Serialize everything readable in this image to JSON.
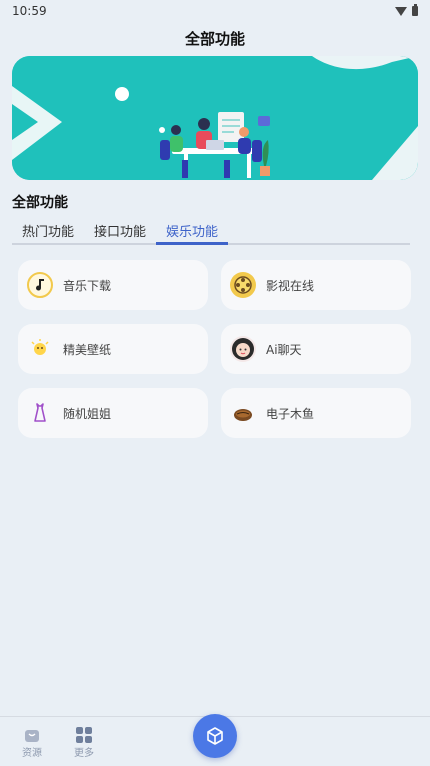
{
  "status": {
    "time": "10:59"
  },
  "header": {
    "title": "全部功能"
  },
  "section": {
    "title": "全部功能"
  },
  "tabs": [
    {
      "label": "热门功能",
      "active": false
    },
    {
      "label": "接口功能",
      "active": false
    },
    {
      "label": "娱乐功能",
      "active": true
    }
  ],
  "cards": [
    {
      "label": "音乐下载",
      "icon": "music-note-icon"
    },
    {
      "label": "影视在线",
      "icon": "film-reel-icon"
    },
    {
      "label": "精美壁纸",
      "icon": "wallpaper-icon"
    },
    {
      "label": "Ai聊天",
      "icon": "ai-avatar-icon"
    },
    {
      "label": "随机姐姐",
      "icon": "dress-icon"
    },
    {
      "label": "电子木鱼",
      "icon": "wooden-fish-icon"
    }
  ],
  "bottom_nav": {
    "resources_label": "资源",
    "more_label": "更多"
  },
  "colors": {
    "accent": "#3e63c9",
    "banner": "#1fc1bb",
    "fab": "#4b78e6"
  }
}
